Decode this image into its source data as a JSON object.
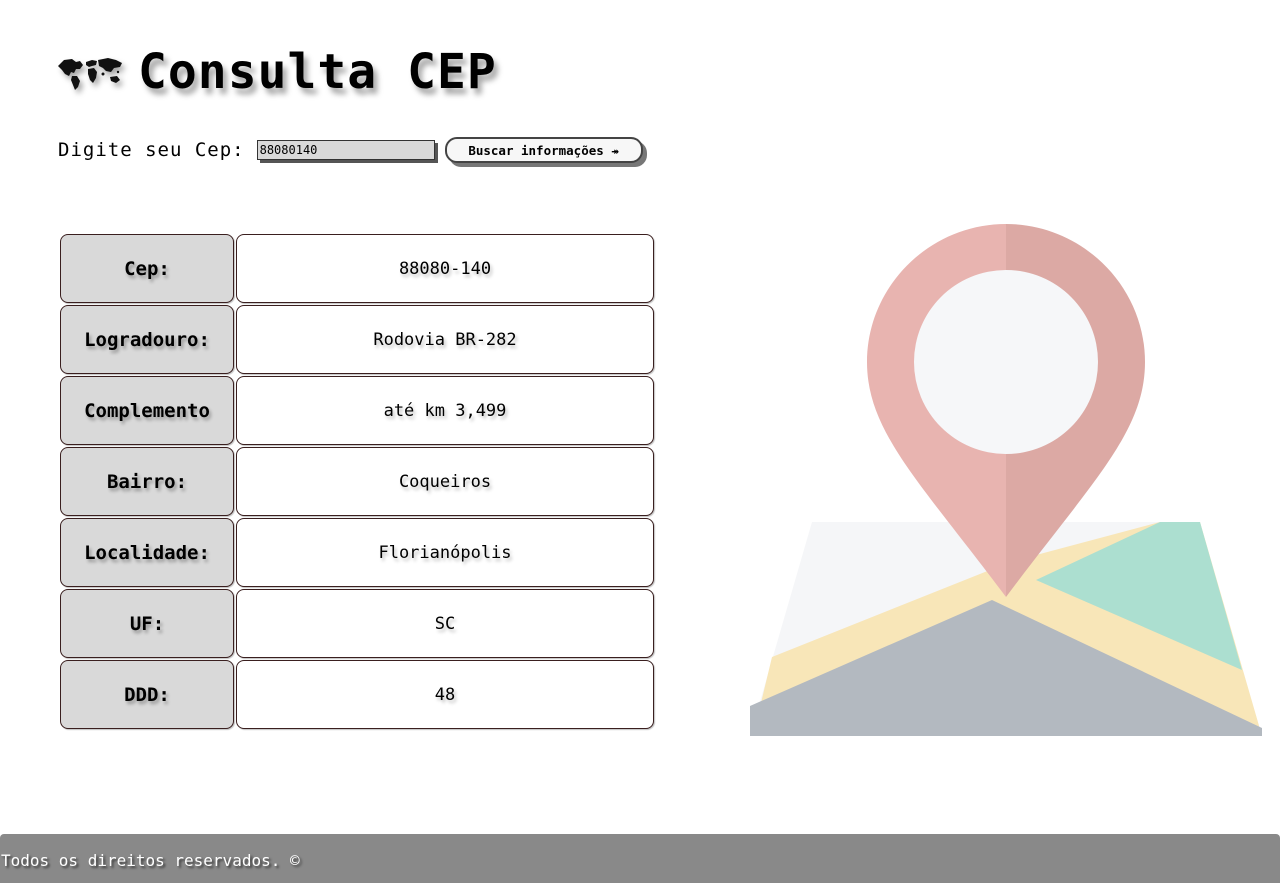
{
  "header": {
    "title": "Consulta CEP",
    "icon": "world-map-icon"
  },
  "search": {
    "label": "Digite seu Cep:",
    "input_value": "88080140",
    "button_label": "Buscar informações ↠"
  },
  "info": {
    "rows": [
      {
        "label": "Cep:",
        "value": "88080-140"
      },
      {
        "label": "Logradouro:",
        "value": "Rodovia BR-282"
      },
      {
        "label": "Complemento",
        "value": "até km 3,499"
      },
      {
        "label": "Bairro:",
        "value": "Coqueiros"
      },
      {
        "label": "Localidade:",
        "value": "Florianópolis"
      },
      {
        "label": "UF:",
        "value": "SC"
      },
      {
        "label": "DDD:",
        "value": "48"
      }
    ]
  },
  "illustration": {
    "icon": "map-pin-icon",
    "colors": {
      "pin_light": "#e8b4b0",
      "pin_dark": "#dca9a4",
      "pin_center": "#f6f7f9",
      "map_white": "#f5f6f8",
      "map_yellow": "#f8e6b8",
      "map_green": "#acdfd0",
      "map_gray": "#b3b9c0"
    }
  },
  "footer": {
    "text": "Todos os direitos reservados. ©",
    "background": "#898989"
  }
}
